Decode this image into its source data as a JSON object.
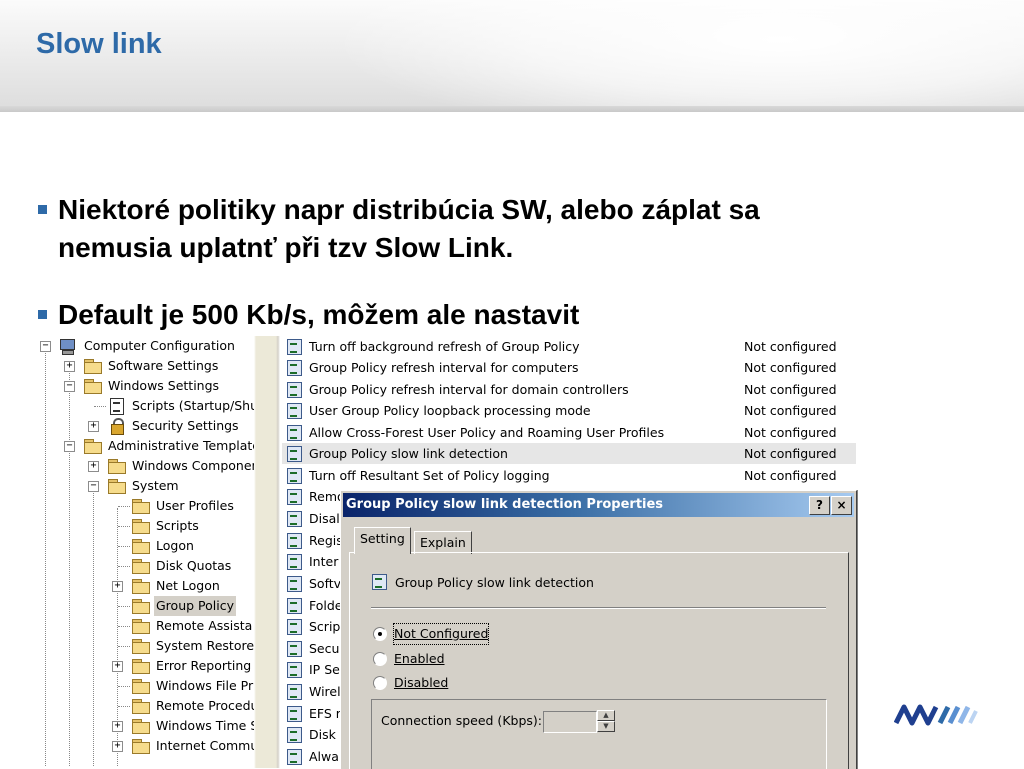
{
  "slide": {
    "title": "Slow link",
    "bullets": [
      "Niektoré politiky napr distribúcia SW, alebo záplat sa",
      "nemusia uplatnť při tzv Slow Link.",
      "Default je 500 Kb/s, môžem ale nastavit"
    ],
    "accent_color": "#2e6aa8"
  },
  "tree": {
    "items": [
      {
        "label": "Computer Configuration",
        "icon": "computer-icon",
        "expander": "−"
      },
      {
        "label": "Software Settings",
        "icon": "folder-icon",
        "expander": "+"
      },
      {
        "label": "Windows Settings",
        "icon": "folder-icon",
        "expander": "−"
      },
      {
        "label": "Scripts (Startup/Shu",
        "icon": "script-icon",
        "expander": ""
      },
      {
        "label": "Security Settings",
        "icon": "security-icon",
        "expander": "+"
      },
      {
        "label": "Administrative Template",
        "icon": "folder-icon",
        "expander": "−"
      },
      {
        "label": "Windows Componen",
        "icon": "folder-icon",
        "expander": "+"
      },
      {
        "label": "System",
        "icon": "folder-icon",
        "expander": "−"
      },
      {
        "label": "User Profiles",
        "icon": "folder-icon",
        "expander": ""
      },
      {
        "label": "Scripts",
        "icon": "folder-icon",
        "expander": ""
      },
      {
        "label": "Logon",
        "icon": "folder-icon",
        "expander": ""
      },
      {
        "label": "Disk Quotas",
        "icon": "folder-icon",
        "expander": ""
      },
      {
        "label": "Net Logon",
        "icon": "folder-icon",
        "expander": "+"
      },
      {
        "label": "Group Policy",
        "icon": "folder-open-icon",
        "expander": "",
        "selected": true
      },
      {
        "label": "Remote Assista",
        "icon": "folder-icon",
        "expander": ""
      },
      {
        "label": "System Restore",
        "icon": "folder-icon",
        "expander": ""
      },
      {
        "label": "Error Reporting",
        "icon": "folder-icon",
        "expander": "+"
      },
      {
        "label": "Windows File Pr",
        "icon": "folder-icon",
        "expander": ""
      },
      {
        "label": "Remote Procedu",
        "icon": "folder-icon",
        "expander": ""
      },
      {
        "label": "Windows Time S",
        "icon": "folder-icon",
        "expander": "+"
      },
      {
        "label": "Internet Commu",
        "icon": "folder-icon",
        "expander": "+"
      }
    ]
  },
  "policy_list": {
    "rows": [
      {
        "name": "Turn off background refresh of Group Policy",
        "state": "Not configured"
      },
      {
        "name": "Group Policy refresh interval for computers",
        "state": "Not configured"
      },
      {
        "name": "Group Policy refresh interval for domain controllers",
        "state": "Not configured"
      },
      {
        "name": "User Group Policy loopback processing mode",
        "state": "Not configured"
      },
      {
        "name": "Allow Cross-Forest User Policy and Roaming User Profiles",
        "state": "Not configured"
      },
      {
        "name": "Group Policy slow link detection",
        "state": "Not configured",
        "highlight": true
      },
      {
        "name": "Turn off Resultant Set of Policy logging",
        "state": "Not configured"
      },
      {
        "name": "Remo",
        "state": ""
      },
      {
        "name": "Disall",
        "state": ""
      },
      {
        "name": "Regis",
        "state": ""
      },
      {
        "name": "Inter",
        "state": ""
      },
      {
        "name": "Softv",
        "state": ""
      },
      {
        "name": "Folde",
        "state": ""
      },
      {
        "name": "Script",
        "state": ""
      },
      {
        "name": "Secur",
        "state": ""
      },
      {
        "name": "IP Se",
        "state": ""
      },
      {
        "name": "Wirel",
        "state": ""
      },
      {
        "name": "EFS r",
        "state": ""
      },
      {
        "name": "Disk C",
        "state": ""
      },
      {
        "name": "Alwa",
        "state": ""
      }
    ]
  },
  "dialog": {
    "title": "Group Policy slow link detection Properties",
    "help_label": "?",
    "close_label": "×",
    "tabs": [
      "Setting",
      "Explain"
    ],
    "policy_name": "Group Policy slow link detection",
    "options": [
      {
        "label": "Not Configured",
        "checked": true
      },
      {
        "label": "Enabled",
        "checked": false
      },
      {
        "label": "Disabled",
        "checked": false
      }
    ],
    "speed_label": "Connection speed (Kbps):",
    "speed_value": "",
    "title_color": "#0a246a"
  }
}
